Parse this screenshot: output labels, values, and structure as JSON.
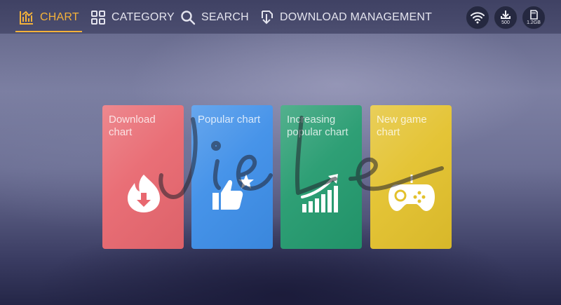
{
  "nav": {
    "items": [
      {
        "label": "CHART",
        "icon": "bar-chart-icon",
        "active": true
      },
      {
        "label": "CATEGORY",
        "icon": "grid-icon",
        "active": false
      },
      {
        "label": "SEARCH",
        "icon": "search-icon",
        "active": false
      },
      {
        "label": "DOWNLOAD MANAGEMENT",
        "icon": "download-management-icon",
        "active": false
      }
    ]
  },
  "status": {
    "wifi_icon": "wifi-icon",
    "downloads": {
      "icon": "download-icon",
      "value": "500"
    },
    "storage": {
      "icon": "sd-card-icon",
      "value": "1.2GB"
    }
  },
  "cards": [
    {
      "title": "Download chart",
      "icon": "flame-download-icon",
      "color": "#e8676f"
    },
    {
      "title": "Popular chart",
      "icon": "thumbs-up-star-icon",
      "color": "#3d8ee8"
    },
    {
      "title": "Increasing popular chart",
      "icon": "rising-bars-icon",
      "color": "#239a6e"
    },
    {
      "title": "New game chart",
      "icon": "gamepad-icon",
      "color": "#e3c12c"
    }
  ],
  "colors": {
    "accent": "#f4b23a",
    "topbar": "#3e4062"
  }
}
